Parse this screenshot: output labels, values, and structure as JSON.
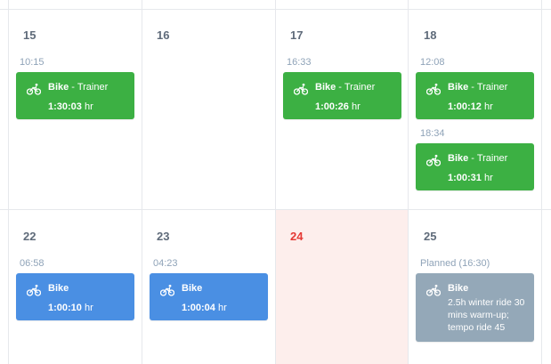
{
  "colors": {
    "completed": "#3cb043",
    "completed_plain": "#4a8fe3",
    "planned": "#94a8b8",
    "today_bg": "#fdeeec",
    "today_text": "#e53935"
  },
  "week1": {
    "days": [
      "15",
      "16",
      "17",
      "18"
    ],
    "workouts": [
      {
        "time": "10:15",
        "type": "Bike",
        "sub": " - Trainer",
        "duration": "1:30:03",
        "unit": " hr",
        "icon": "bike-icon"
      },
      {
        "time": "16:33",
        "type": "Bike",
        "sub": " - Trainer",
        "duration": "1:00:26",
        "unit": " hr",
        "icon": "bike-icon"
      },
      {
        "time": "12:08",
        "type": "Bike",
        "sub": " - Trainer",
        "duration": "1:00:12",
        "unit": " hr",
        "icon": "bike-icon"
      },
      {
        "time": "18:34",
        "type": "Bike",
        "sub": " - Trainer",
        "duration": "1:00:31",
        "unit": " hr",
        "icon": "bike-icon"
      }
    ]
  },
  "week2": {
    "days": [
      "22",
      "23",
      "24",
      "25"
    ],
    "workouts": [
      {
        "time": "06:58",
        "type": "Bike",
        "duration": "1:00:10",
        "unit": " hr",
        "icon": "bike-icon"
      },
      {
        "time": "04:23",
        "type": "Bike",
        "duration": "1:00:04",
        "unit": " hr",
        "icon": "bike-icon"
      }
    ],
    "planned": {
      "time": "Planned (16:30)",
      "type": "Bike",
      "description": "2.5h winter ride 30 mins warm-up; tempo ride 45",
      "icon": "bike-icon"
    }
  }
}
